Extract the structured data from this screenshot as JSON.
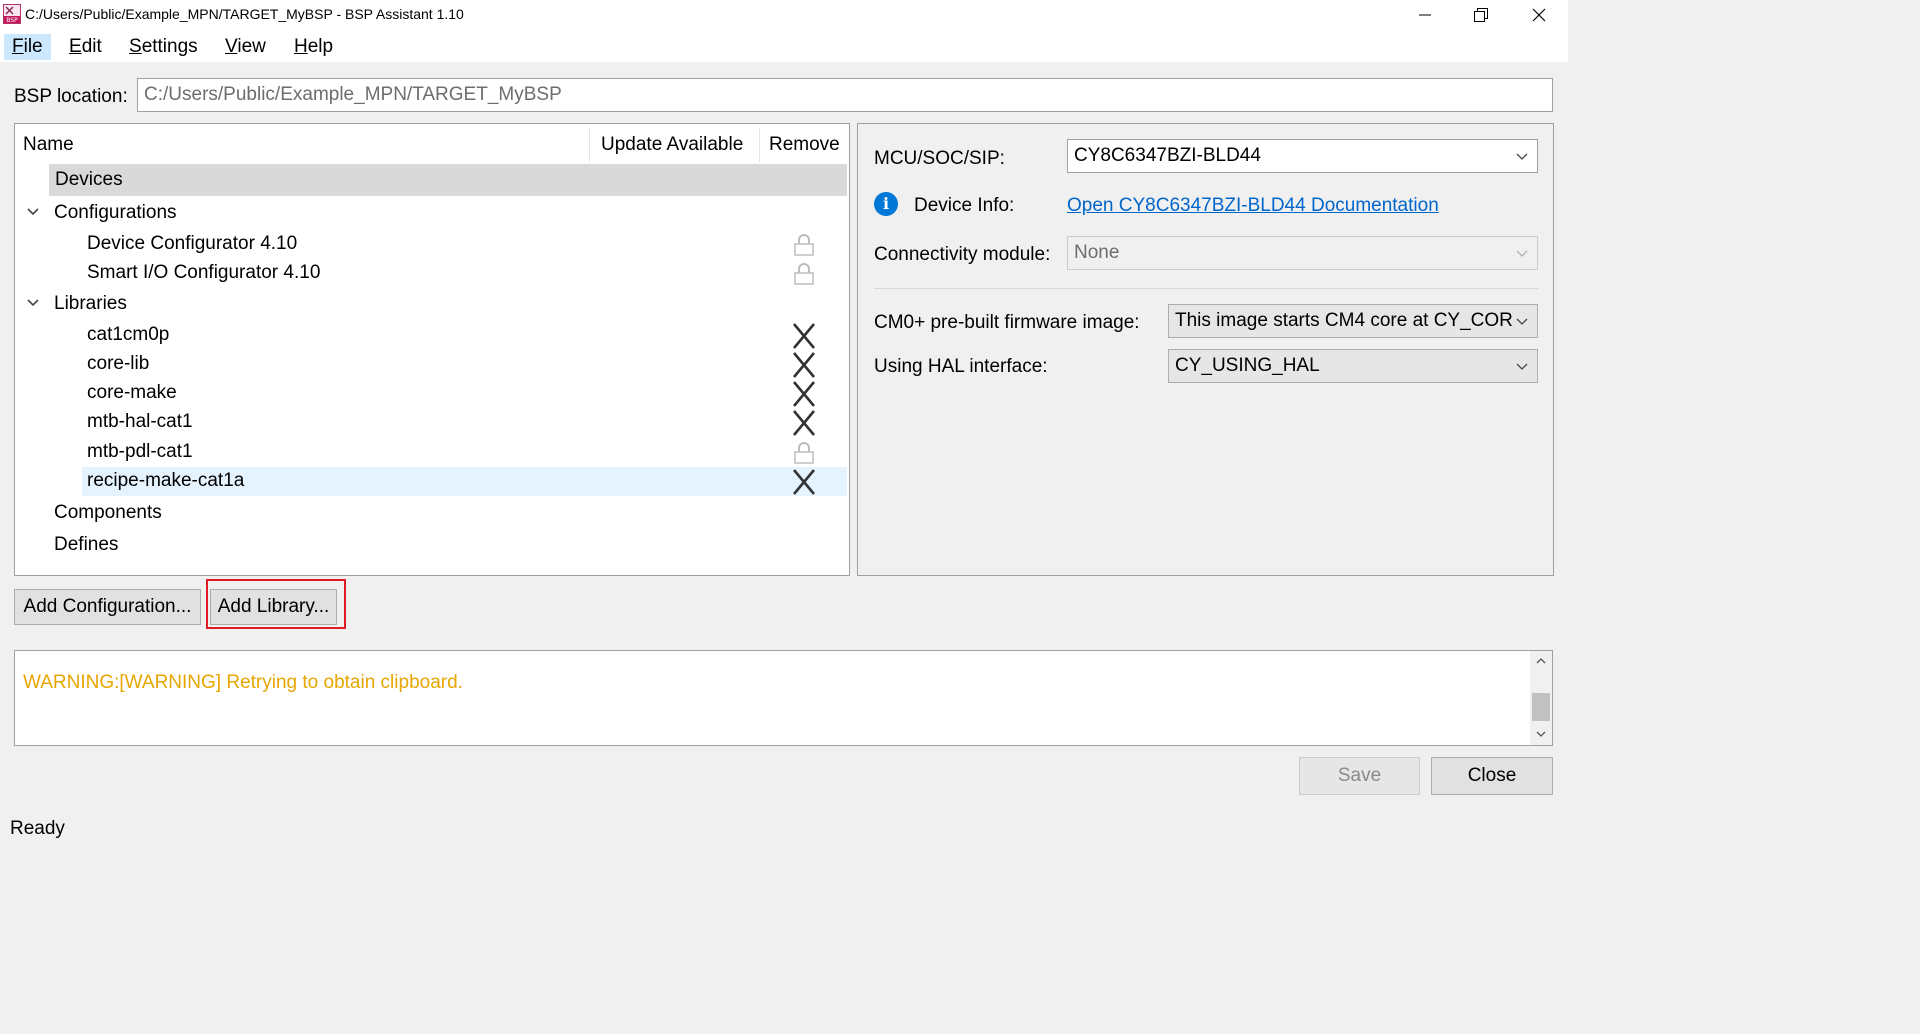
{
  "window": {
    "title": "C:/Users/Public/Example_MPN/TARGET_MyBSP - BSP Assistant 1.10",
    "icon_text": "BSP"
  },
  "menu": [
    {
      "label_first": "F",
      "label_rest": "ile"
    },
    {
      "label_first": "E",
      "label_rest": "dit"
    },
    {
      "label_first": "S",
      "label_rest": "ettings"
    },
    {
      "label_first": "V",
      "label_rest": "iew"
    },
    {
      "label_first": "H",
      "label_rest": "elp"
    }
  ],
  "bsp": {
    "label": "BSP location:",
    "value": "C:/Users/Public/Example_MPN/TARGET_MyBSP"
  },
  "tree": {
    "columns": {
      "name": "Name",
      "update": "Update Available",
      "remove": "Remove"
    },
    "rows": [
      {
        "label": "Devices",
        "remove_icon": "none"
      },
      {
        "label": "Configurations",
        "remove_icon": "none"
      },
      {
        "label": "Device Configurator 4.10",
        "remove_icon": "lock-icon"
      },
      {
        "label": "Smart I/O Configurator 4.10",
        "remove_icon": "lock-icon"
      },
      {
        "label": "Libraries",
        "remove_icon": "none"
      },
      {
        "label": "cat1cm0p",
        "remove_icon": "remove-x-icon"
      },
      {
        "label": "core-lib",
        "remove_icon": "remove-x-icon"
      },
      {
        "label": "core-make",
        "remove_icon": "remove-x-icon"
      },
      {
        "label": "mtb-hal-cat1",
        "remove_icon": "remove-x-icon"
      },
      {
        "label": "mtb-pdl-cat1",
        "remove_icon": "lock-icon"
      },
      {
        "label": "recipe-make-cat1a",
        "remove_icon": "remove-x-icon"
      },
      {
        "label": "Components",
        "remove_icon": "none"
      },
      {
        "label": "Defines",
        "remove_icon": "none"
      }
    ]
  },
  "props": {
    "mcu_label": "MCU/SOC/SIP:",
    "mcu_value": "CY8C6347BZI-BLD44",
    "device_info_label": "Device Info:",
    "device_info_link": "Open CY8C6347BZI-BLD44 Documentation",
    "connectivity_label": "Connectivity module:",
    "connectivity_value": "None",
    "cm0_label": "CM0+ pre-built firmware image:",
    "cm0_value": "This image starts CM4 core at CY_COR",
    "hal_label": "Using HAL interface:",
    "hal_value": "CY_USING_HAL"
  },
  "buttons": {
    "add_configuration": "Add Configuration...",
    "add_library": "Add Library...",
    "save": "Save",
    "close": "Close"
  },
  "log": {
    "message": "WARNING:[WARNING] Retrying to obtain clipboard."
  },
  "status": "Ready",
  "colors": {
    "warning_text": "#e8a600",
    "link": "#0066cc",
    "highlight_border": "#e01b24",
    "info_icon": "#0078d7"
  }
}
